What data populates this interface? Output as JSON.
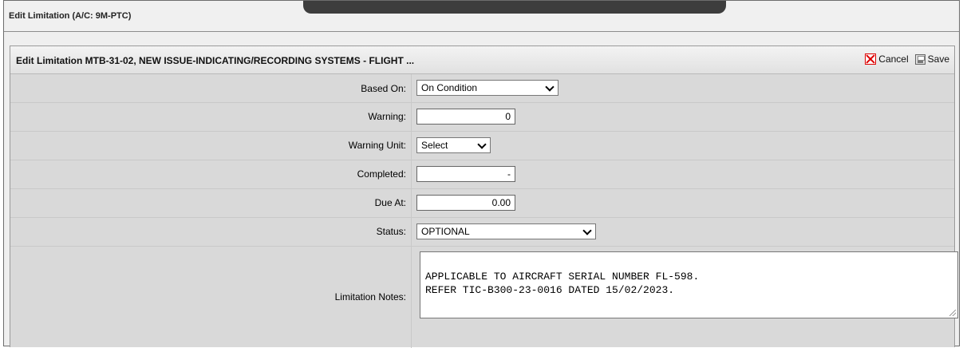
{
  "window": {
    "title": "Edit Limitation (A/C: 9M-PTC)"
  },
  "panel": {
    "title": "Edit Limitation MTB-31-02, NEW ISSUE-INDICATING/RECORDING SYSTEMS - FLIGHT ...",
    "cancel_label": "Cancel",
    "save_label": "Save"
  },
  "form": {
    "based_on": {
      "label": "Based On:",
      "value": "On Condition"
    },
    "warning": {
      "label": "Warning:",
      "value": "0"
    },
    "warning_unit": {
      "label": "Warning Unit:",
      "value": "Select"
    },
    "completed": {
      "label": "Completed:",
      "value": "-"
    },
    "due_at": {
      "label": "Due At:",
      "value": "0.00"
    },
    "status": {
      "label": "Status:",
      "value": "OPTIONAL"
    },
    "notes": {
      "label": "Limitation Notes:",
      "value": "APPLICABLE TO AIRCRAFT SERIAL NUMBER FL-598.\nREFER TIC-B300-23-0016 DATED 15/02/2023."
    }
  },
  "icons": {
    "cancel": "close-icon",
    "save": "save-icon"
  }
}
